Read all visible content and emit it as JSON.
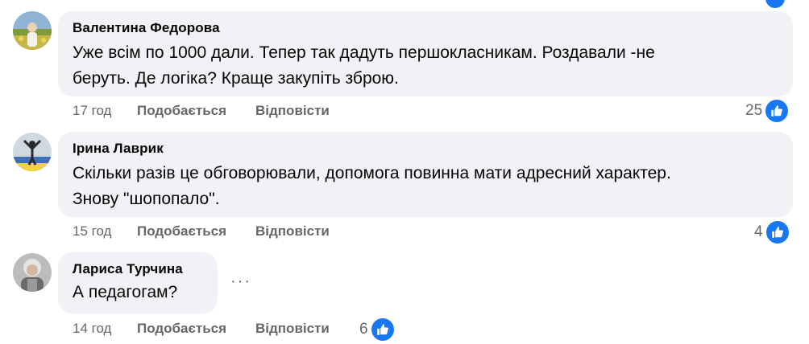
{
  "comments": [
    {
      "author": "Валентина Федорова",
      "text_line1": "Уже всім по 1000 дали. Тепер так дадуть першокласникам. Роздавали -не",
      "text_line2": "беруть. Де логіка? Краще закупіть зброю.",
      "time": "17 год",
      "like_label": "Подобається",
      "reply_label": "Відповісти",
      "reactions": "25"
    },
    {
      "author": "Ірина Лаврик",
      "text_line1": "Скільки разів це обговорювали, допомога повинна мати адресний характер.",
      "text_line2": "Знову \"шопопало\".",
      "time": "15 год",
      "like_label": "Подобається",
      "reply_label": "Відповісти",
      "reactions": "4"
    },
    {
      "author": "Лариса Турчина",
      "text_line1": "А педагогам?",
      "time": "14 год",
      "like_label": "Подобається",
      "reply_label": "Відповісти",
      "reactions": "6",
      "more_label": "···"
    }
  ],
  "colors": {
    "bubble": "#f0f2f5",
    "meta": "#65676b",
    "like_blue": "#1877f2",
    "text": "#050505"
  }
}
